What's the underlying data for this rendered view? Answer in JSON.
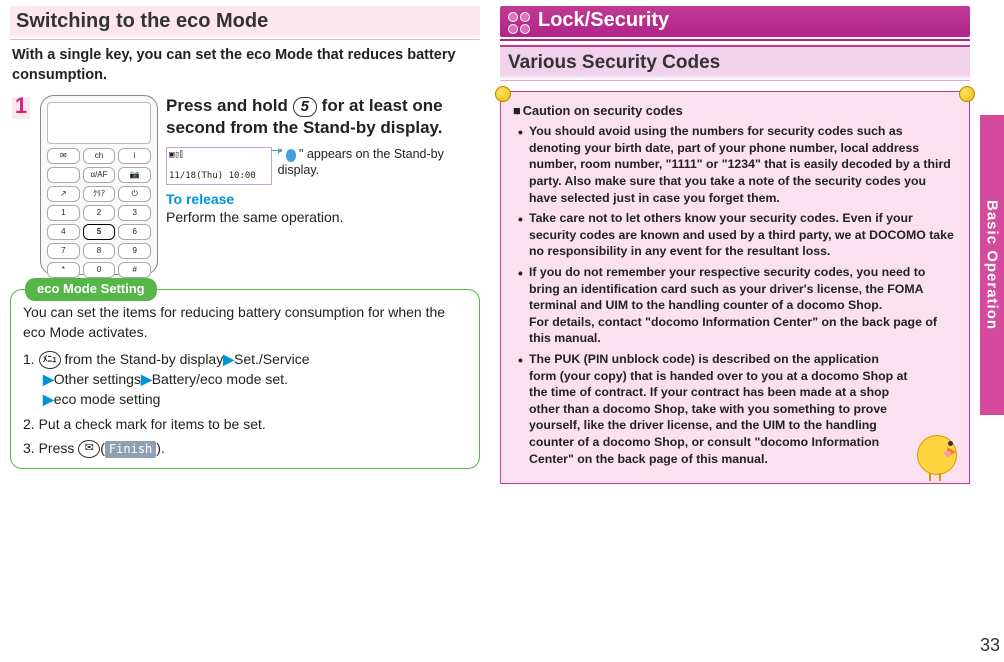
{
  "page_number": "33",
  "side_tab": "Basic Operation",
  "left": {
    "title": "Switching to the eco Mode",
    "lead": "With a single key, you can set the eco Mode that reduces battery consumption.",
    "step_number": "1",
    "instruction_pre": "Press and hold ",
    "instruction_key": "5",
    "instruction_post": " for at least one second from the Stand-by display.",
    "mini_display_line1": "▣▯⫿",
    "mini_display_line2": "11/18(Thu) 10:00",
    "mini_caption_pre": "\" ",
    "mini_caption_post": " \" appears on the Stand-by display.",
    "release_label": "To release",
    "release_text": "Perform the same operation.",
    "eco_tab": "eco Mode Setting",
    "eco_intro": "You can set the items for reducing battery consumption for when the eco Mode activates.",
    "eco_s1_num": "1. ",
    "eco_s1_menu": "ﾒﾆｭ",
    "eco_s1_a": " from the Stand-by display",
    "eco_s1_b": "Set./Service",
    "eco_s1_c": "Other settings",
    "eco_s1_d": "Battery/eco mode set.",
    "eco_s1_e": "eco mode setting",
    "eco_s2": "2. Put a check mark for items to be set.",
    "eco_s3_pre": "3. Press ",
    "eco_s3_mail": "✉",
    "eco_s3_paren_open": "(",
    "eco_s3_finish": "Finish",
    "eco_s3_paren_close": ").",
    "tri": "▶"
  },
  "right": {
    "lock_header": "Lock/Security",
    "varcodes_title": "Various Security Codes",
    "caution_heading": "Caution on security codes",
    "bullets": [
      "You should avoid using the numbers for security codes such as denoting your birth date, part of your phone number, local address number, room number, \"1111\" or \"1234\" that is easily decoded by a third party. Also make sure that you take a note of the security codes you have selected just in case you forget them.",
      "Take care not to let others know your security codes. Even if your security codes are known and used by a third party, we at DOCOMO take no responsibility in any event for the resultant loss.",
      "If you do not remember your respective security codes, you need to bring an identification card such as your driver's license, the FOMA terminal and UIM to the handling counter of a docomo Shop.\nFor details, contact \"docomo Information Center\" on the back page of this manual.",
      "The PUK (PIN unblock code) is described on the application form (your copy) that is handed over to you at a docomo Shop at the time of contract. If your contract has been made at a shop other than a docomo Shop, take with you something to prove yourself, like the driver license, and the UIM to the handling counter of a docomo Shop, or consult \"docomo Information Center\" on the back page of this manual."
    ]
  }
}
